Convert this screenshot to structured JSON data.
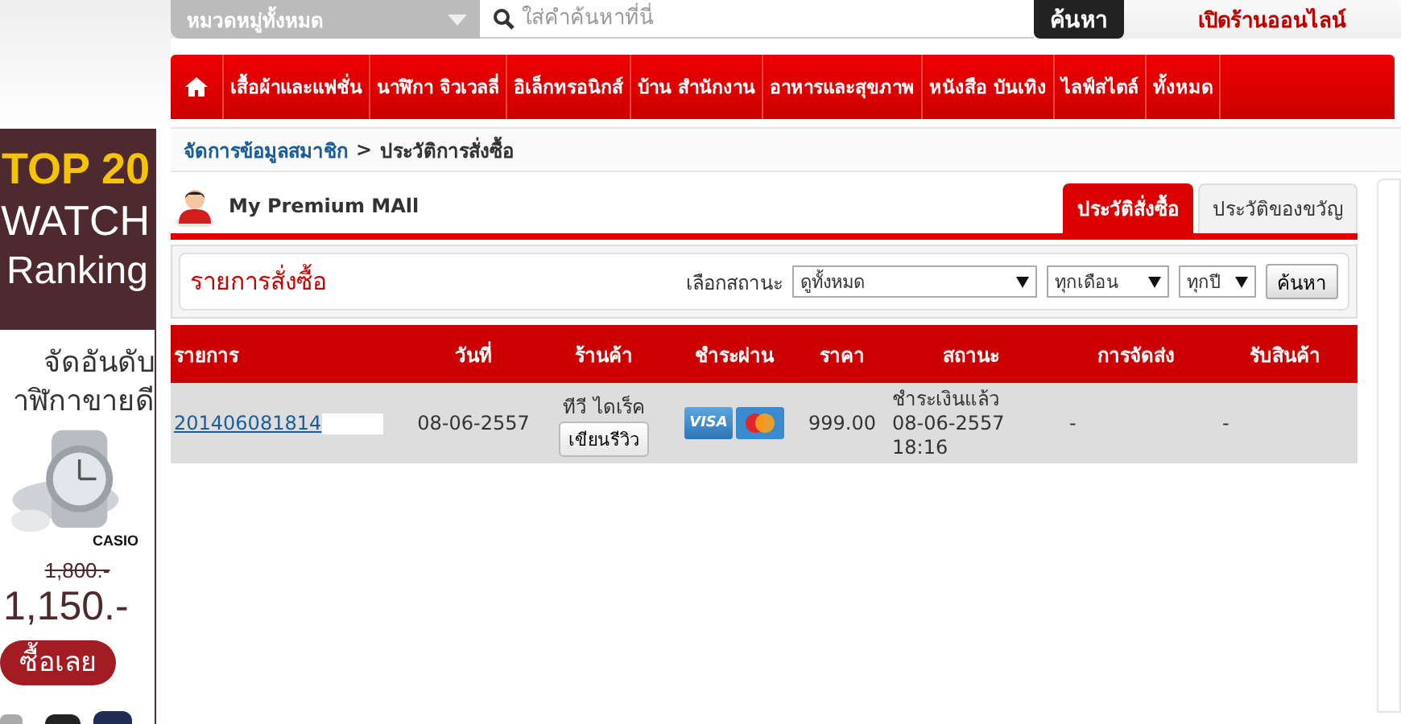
{
  "header": {
    "category": "หมวดหมู่ทั้งหมด",
    "search_placeholder": "ใส่คำค้นหาที่นี่",
    "search_button": "ค้นหา",
    "open_shop": "เปิดร้านออนไลน์"
  },
  "nav": [
    "เสื้อผ้าและแฟชั่น",
    "นาฬิกา จิวเวลลี่",
    "อิเล็กทรอนิกส์",
    "บ้าน สำนักงาน",
    "อาหารและสุขภาพ",
    "หนังสือ บันเทิง",
    "ไลฟ์สไตล์",
    "ทั้งหมด"
  ],
  "ad": {
    "top": "TOP 20",
    "title": "WATCH",
    "sub": "Ranking",
    "line1": "จัดอันดับ",
    "line2": "าฬิกาขายดี",
    "brand": "CASIO",
    "old_price": "1,800.-",
    "price": "1,150.-",
    "button": "ซื้อเลย"
  },
  "breadcrumb": {
    "parent": "จัดการข้อมูลสมาชิก",
    "sep": ">",
    "current": "ประวัติการสั่งซื้อ"
  },
  "user": "My Premium MAll",
  "tabs": [
    {
      "label": "ประวัติสั่งซื้อ",
      "selected": true
    },
    {
      "label": "ประวัติของขวัญ",
      "selected": false
    }
  ],
  "filter": {
    "title": "รายการสั่งซื้อ",
    "status_label": "เลือกสถานะ",
    "status": "ดูทั้งหมด",
    "month": "ทุกเดือน",
    "year": "ทุกปี",
    "button": "ค้นหา"
  },
  "table": {
    "columns": [
      "รายการ",
      "วันที่",
      "ร้านค้า",
      "ชำระผ่าน",
      "ราคา",
      "สถานะ",
      "การจัดส่ง",
      "รับสินค้า"
    ],
    "rows": [
      {
        "order": "201406081814",
        "date": "08-06-2557",
        "shop": "ทีวี ไดเร็ค",
        "review": "เขียนรีวิว",
        "payments": [
          {
            "kind": "visa",
            "label": "VISA"
          },
          {
            "kind": "mastercard"
          }
        ],
        "price": "999.00",
        "status": [
          "ชำระเงินแล้ว",
          "08-06-2557",
          "18:16"
        ],
        "shipping": "-",
        "received": "-"
      }
    ]
  }
}
